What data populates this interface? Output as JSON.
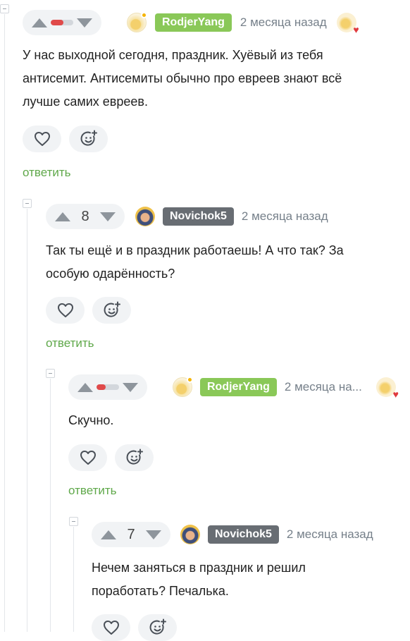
{
  "icons": {
    "upvote": "arrow-up-icon",
    "downvote": "arrow-down-icon",
    "like": "heart-icon",
    "react": "smile-plus-icon",
    "collapse": "minus-icon",
    "badge": "award-heart-icon"
  },
  "colors": {
    "nick_green": "#8ac858",
    "nick_gray": "#686d73",
    "reply_green": "#5fa84a",
    "rating_negative": "#e04a4a"
  },
  "comments": [
    {
      "author": "RodjerYang",
      "time": "2 месяца назад",
      "rating_display": "bar",
      "rating_bar_fraction": 0.55,
      "text_lines": [
        "У нас выходной сегодня, праздник. Хуёвый из тебя",
        "антисемит. Антисемиты обычно про евреев знают всё",
        "лучше самих евреев."
      ],
      "reply_label": "ответить"
    },
    {
      "author": "Novichok5",
      "time": "2 месяца назад",
      "rating": "8",
      "text_lines": [
        "Так ты ещё и в праздник работаешь! А что так? За",
        "особую одарённость?"
      ],
      "reply_label": "ответить"
    },
    {
      "author": "RodjerYang",
      "time": "2 месяца на...",
      "rating_display": "bar",
      "rating_bar_fraction": 0.4,
      "text_lines": [
        "Скучно."
      ],
      "reply_label": "ответить"
    },
    {
      "author": "Novichok5",
      "time": "2 месяца назад",
      "rating": "7",
      "text_lines": [
        "Нечем заняться в праздник и решил",
        "поработать? Печалька."
      ]
    }
  ]
}
